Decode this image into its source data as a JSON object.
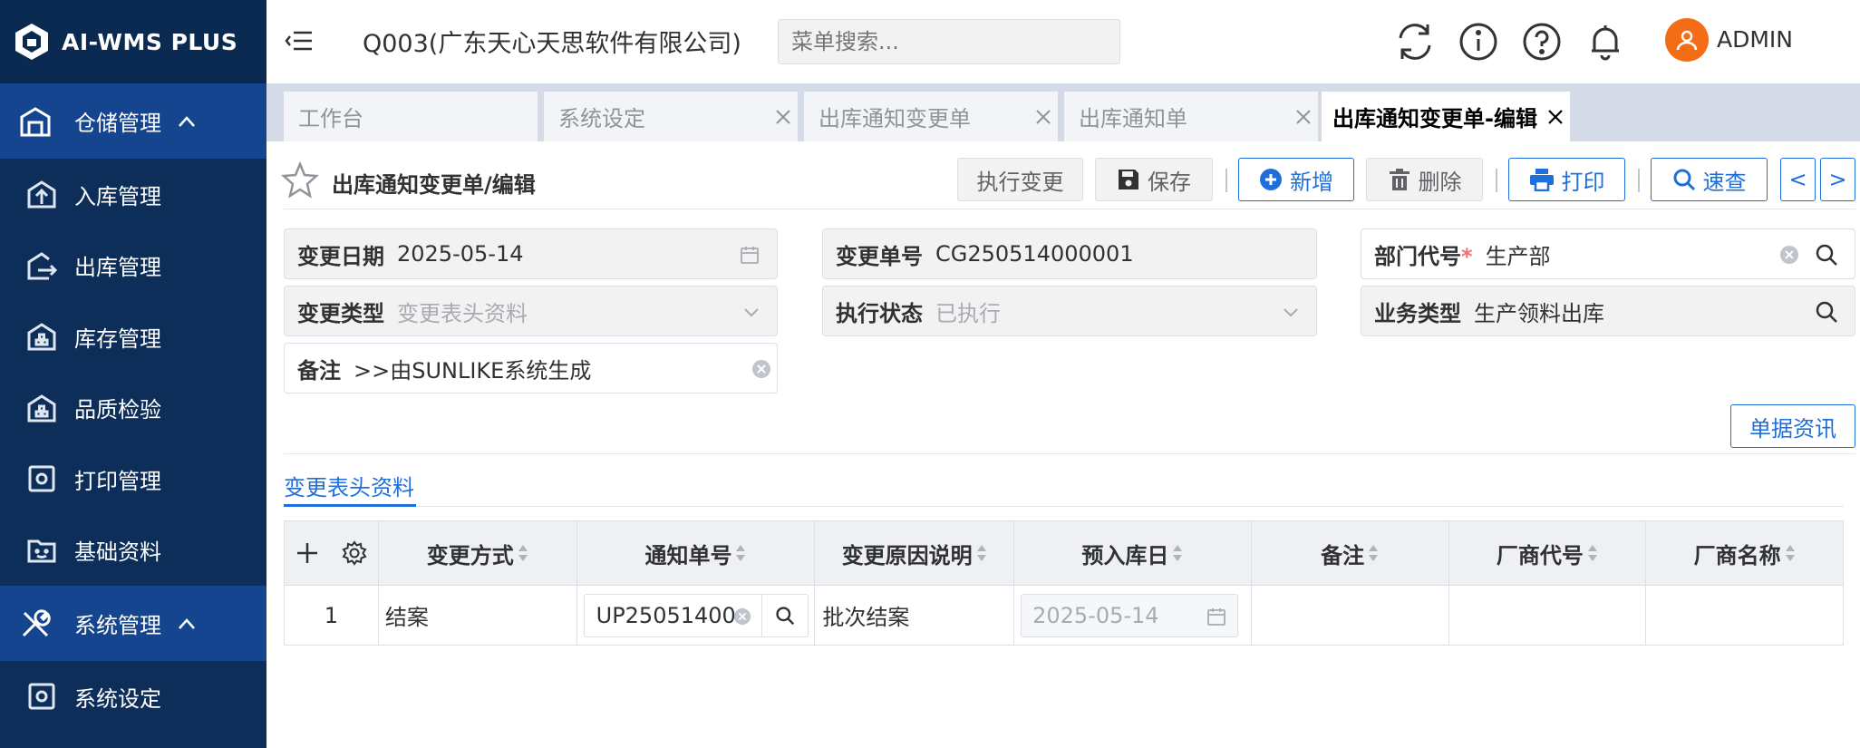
{
  "brand": {
    "name": "AI-WMS PLUS"
  },
  "sidebar": {
    "groups": [
      {
        "label": "仓储管理",
        "icon": "warehouse-icon"
      },
      {
        "label": "系统管理",
        "icon": "tools-icon"
      }
    ],
    "items": [
      {
        "label": "入库管理",
        "icon": "inbound-icon"
      },
      {
        "label": "出库管理",
        "icon": "outbound-icon"
      },
      {
        "label": "库存管理",
        "icon": "inventory-icon"
      },
      {
        "label": "品质检验",
        "icon": "quality-icon"
      },
      {
        "label": "打印管理",
        "icon": "print-settings-icon"
      },
      {
        "label": "基础资料",
        "icon": "folder-icon"
      },
      {
        "label": "系统设定",
        "icon": "settings-icon"
      }
    ]
  },
  "header": {
    "company": "Q003(广东天心天思软件有限公司)",
    "search_placeholder": "菜单搜索...",
    "user": "ADMIN"
  },
  "tabs": [
    {
      "label": "工作台"
    },
    {
      "label": "系统设定"
    },
    {
      "label": "出库通知变更单"
    },
    {
      "label": "出库通知单"
    },
    {
      "label": "出库通知变更单-编辑"
    }
  ],
  "page": {
    "title": "出库通知变更单/编辑"
  },
  "toolbar": {
    "execute": "执行变更",
    "save": "保存",
    "add": "新增",
    "delete": "删除",
    "print": "打印",
    "quick_search": "速查",
    "prev": "<",
    "next": ">"
  },
  "form": {
    "change_date": {
      "label": "变更日期",
      "value": "2025-05-14"
    },
    "change_no": {
      "label": "变更单号",
      "value": "CG250514000001"
    },
    "dept_code": {
      "label": "部门代号",
      "required": "*",
      "value": "生产部"
    },
    "change_type": {
      "label": "变更类型",
      "value": "变更表头资料"
    },
    "exec_status": {
      "label": "执行状态",
      "value": "已执行"
    },
    "biz_type": {
      "label": "业务类型",
      "value": "生产领料出库"
    },
    "remark": {
      "label": "备注",
      "value": ">>由SUNLIKE系统生成"
    }
  },
  "doc_info_button": "单据资讯",
  "subtab": {
    "label": "变更表头资料"
  },
  "table": {
    "columns": [
      "变更方式",
      "通知单号",
      "变更原因说明",
      "预入库日",
      "备注",
      "厂商代号",
      "厂商名称"
    ],
    "rows": [
      {
        "index": "1",
        "method": "结案",
        "notice_no": "UP25051400",
        "reason": "批次结案",
        "date": "2025-05-14",
        "remark": "",
        "vendor_code": "",
        "vendor_name": ""
      }
    ]
  },
  "colors": {
    "sidebar": "#0d2e59",
    "sidebar_active": "#15458f",
    "accent": "#1e6fdc",
    "avatar": "#f56c17"
  }
}
